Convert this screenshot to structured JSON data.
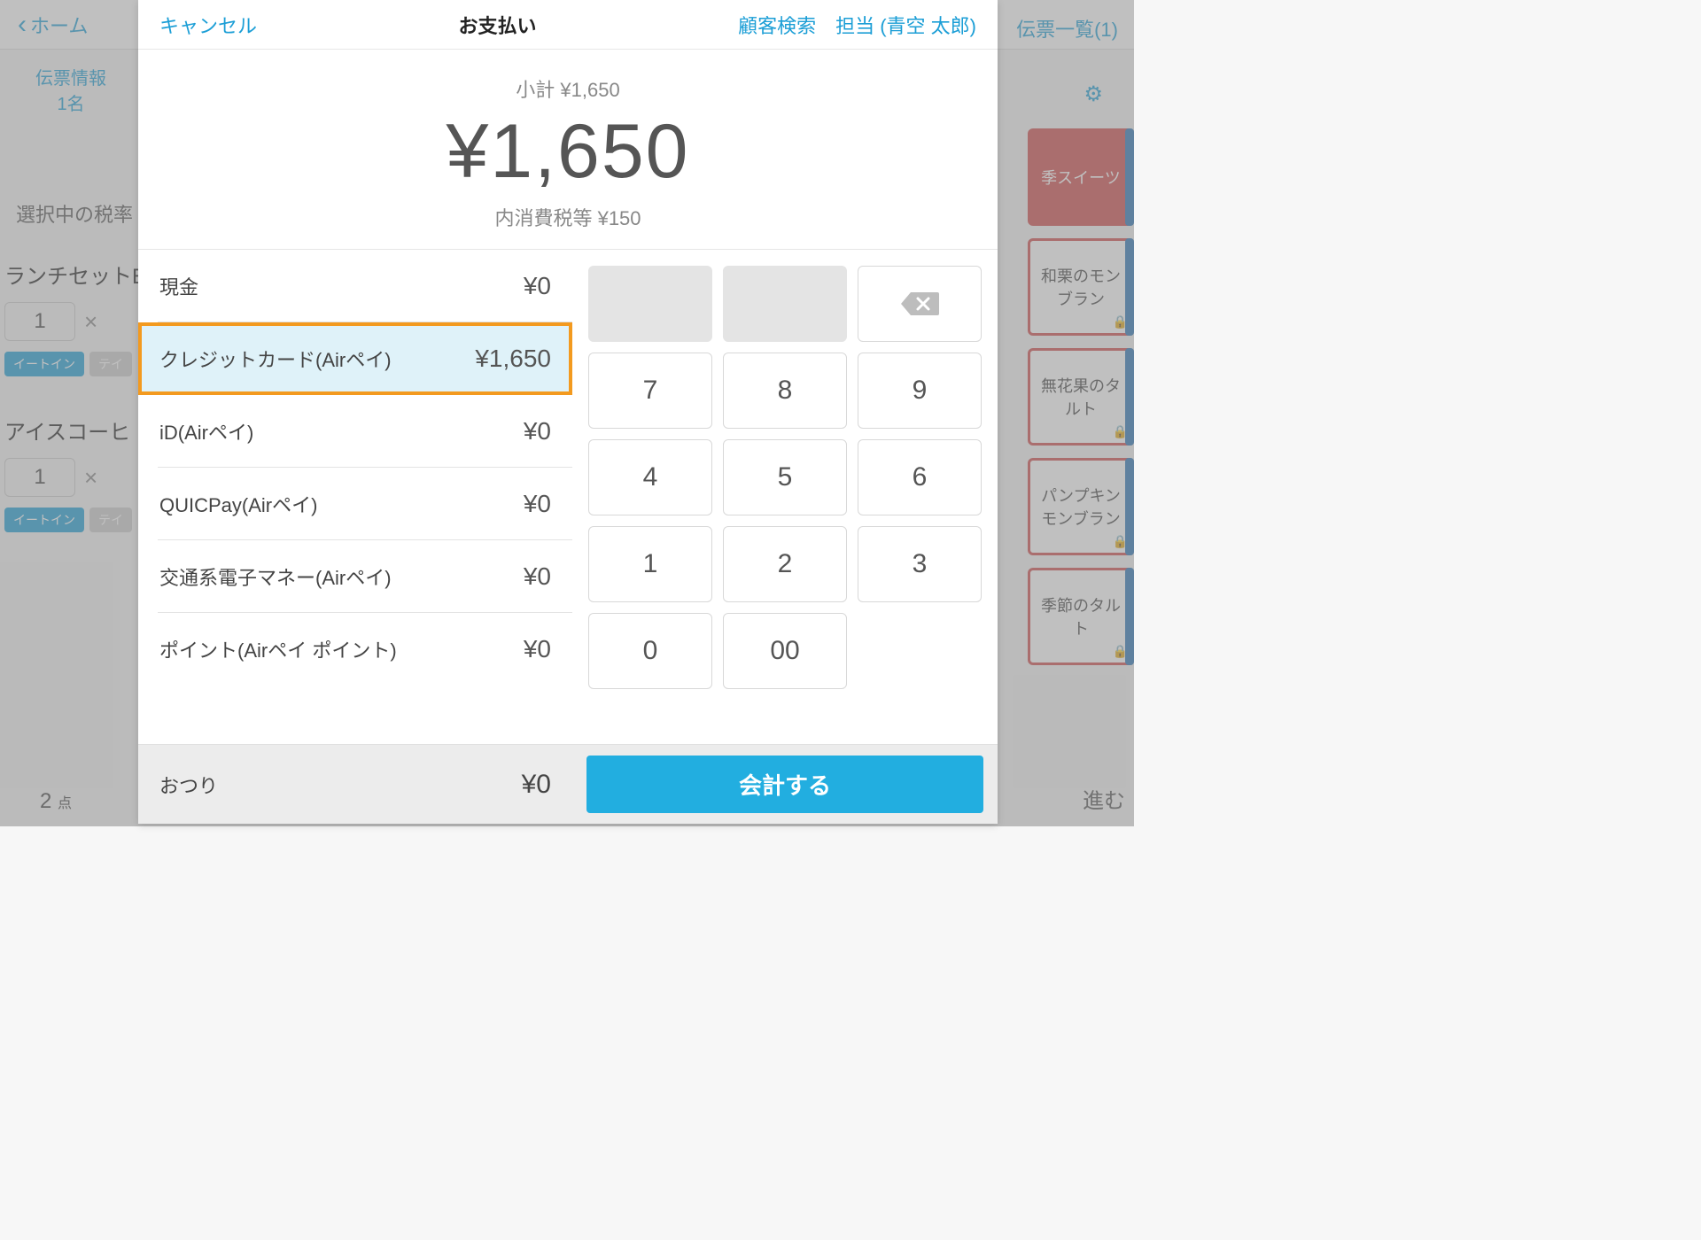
{
  "background": {
    "home": "ホーム",
    "list_button": "伝票一覧(1)",
    "slip_info_line1": "伝票情報",
    "slip_info_line2": "1名",
    "tax_label": "選択中の税率",
    "item1_name": "ランチセットE",
    "item2_name": "アイスコーヒ",
    "qty": "1",
    "tag_eatin": "イートイン",
    "tag_take": "テイ",
    "item_count_num": "2",
    "item_count_unit": "点",
    "proceed": "進む",
    "tiles": {
      "t1": "季スイーツ",
      "t2": "和栗のモンブラン",
      "t3": "無花果のタルト",
      "t4": "パンプキンモンブラン",
      "t5": "季節のタルト"
    }
  },
  "modal": {
    "cancel": "キャンセル",
    "title": "お支払い",
    "customer_search": "顧客検索",
    "staff": "担当 (青空 太郎)",
    "subtotal": "小計 ¥1,650",
    "total": "¥1,650",
    "tax": "内消費税等 ¥150",
    "payments": {
      "cash_label": "現金",
      "cash_amt": "¥0",
      "cc_label": "クレジットカード(Airペイ)",
      "cc_amt": "¥1,650",
      "id_label": "iD(Airペイ)",
      "id_amt": "¥0",
      "quicpay_label": "QUICPay(Airペイ)",
      "quicpay_amt": "¥0",
      "transit_label": "交通系電子マネー(Airペイ)",
      "transit_amt": "¥0",
      "points_label": "ポイント(Airペイ ポイント)",
      "points_amt": "¥0"
    },
    "keypad": {
      "k7": "7",
      "k8": "8",
      "k9": "9",
      "k4": "4",
      "k5": "5",
      "k6": "6",
      "k1": "1",
      "k2": "2",
      "k3": "3",
      "k0": "0",
      "k00": "00"
    },
    "change_label": "おつり",
    "change_amt": "¥0",
    "checkout": "会計する"
  }
}
